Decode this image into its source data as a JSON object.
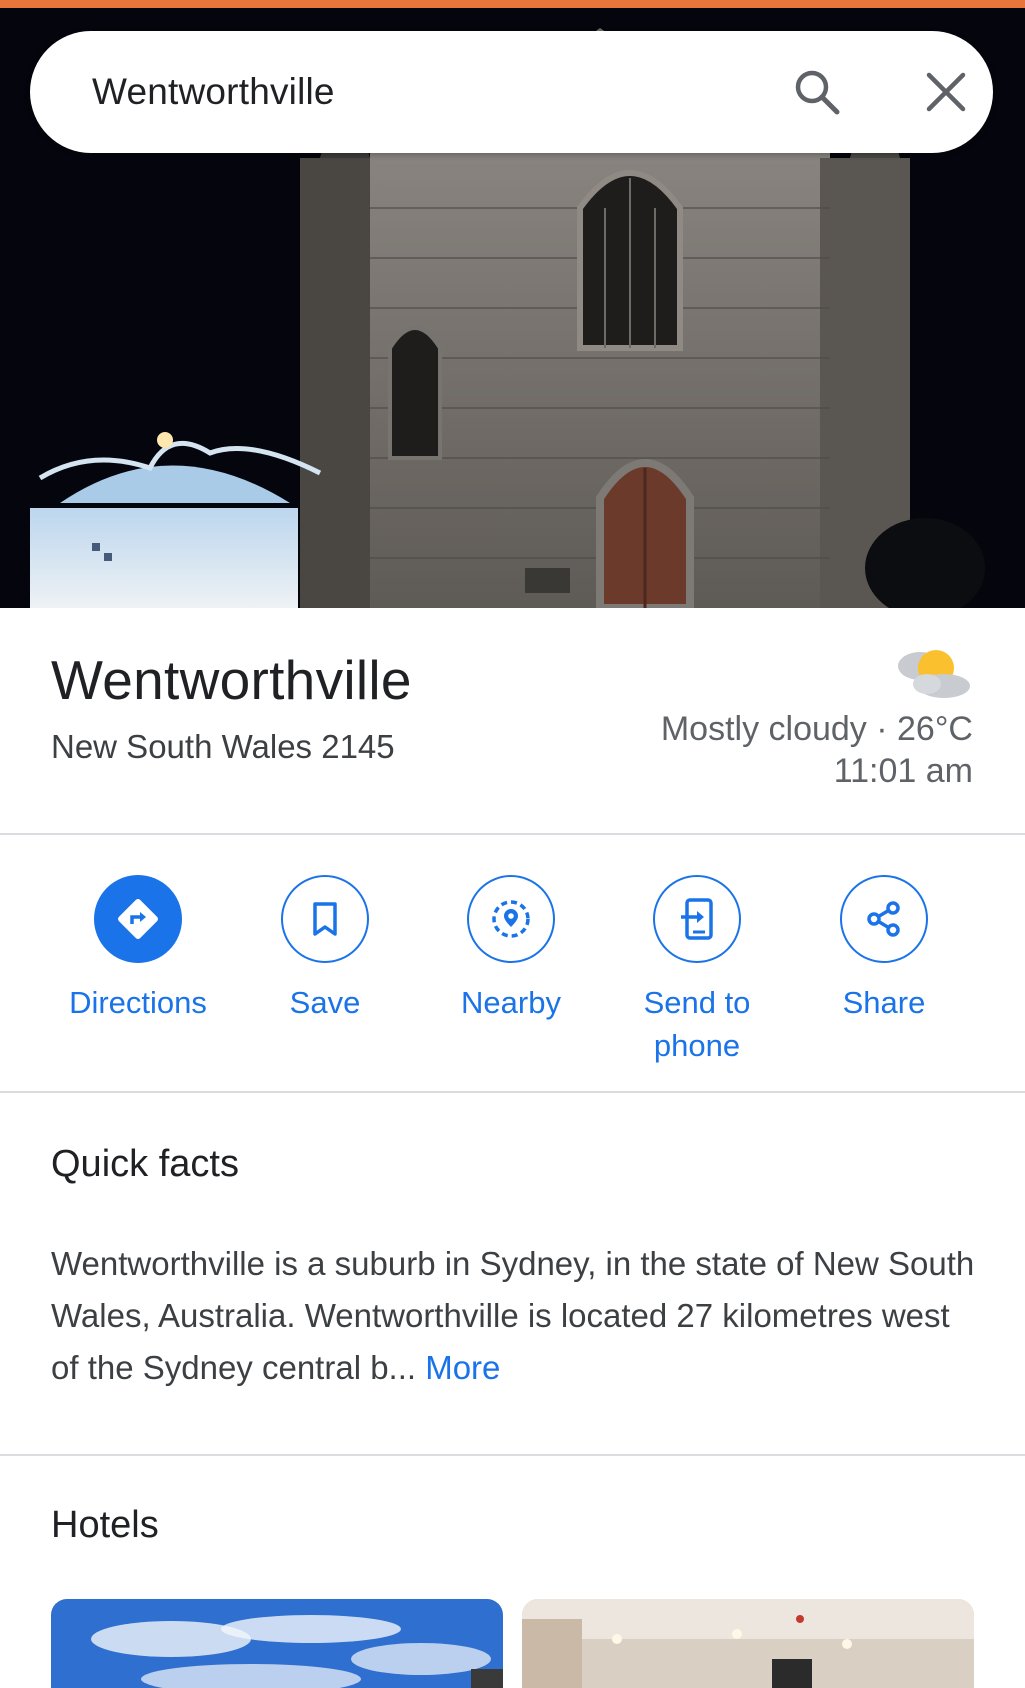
{
  "search": {
    "query": "Wentworthville"
  },
  "place": {
    "title": "Wentworthville",
    "subtitle": "New South Wales 2145"
  },
  "weather": {
    "summary": "Mostly cloudy · 26°C",
    "time": "11:01 am",
    "icon": "partly-cloudy-icon"
  },
  "actions": [
    {
      "label": "Directions",
      "icon": "directions-icon",
      "primary": true
    },
    {
      "label": "Save",
      "icon": "bookmark-icon",
      "primary": false
    },
    {
      "label": "Nearby",
      "icon": "nearby-icon",
      "primary": false
    },
    {
      "label_line1": "Send to",
      "label_line2": "phone",
      "icon": "send-to-phone-icon",
      "primary": false
    },
    {
      "label": "Share",
      "icon": "share-icon",
      "primary": false
    }
  ],
  "quick_facts": {
    "title": "Quick facts",
    "text": "Wentworthville is a suburb in Sydney, in the state of New South Wales, Australia. Wentworthville is located 27 kilometres west of the Sydney central b...",
    "more_label": "More"
  },
  "hotels": {
    "title": "Hotels"
  },
  "colors": {
    "accent": "#1a73e8",
    "top_bar": "#e8763a",
    "text_primary": "#202124",
    "text_secondary": "#5f6368"
  }
}
